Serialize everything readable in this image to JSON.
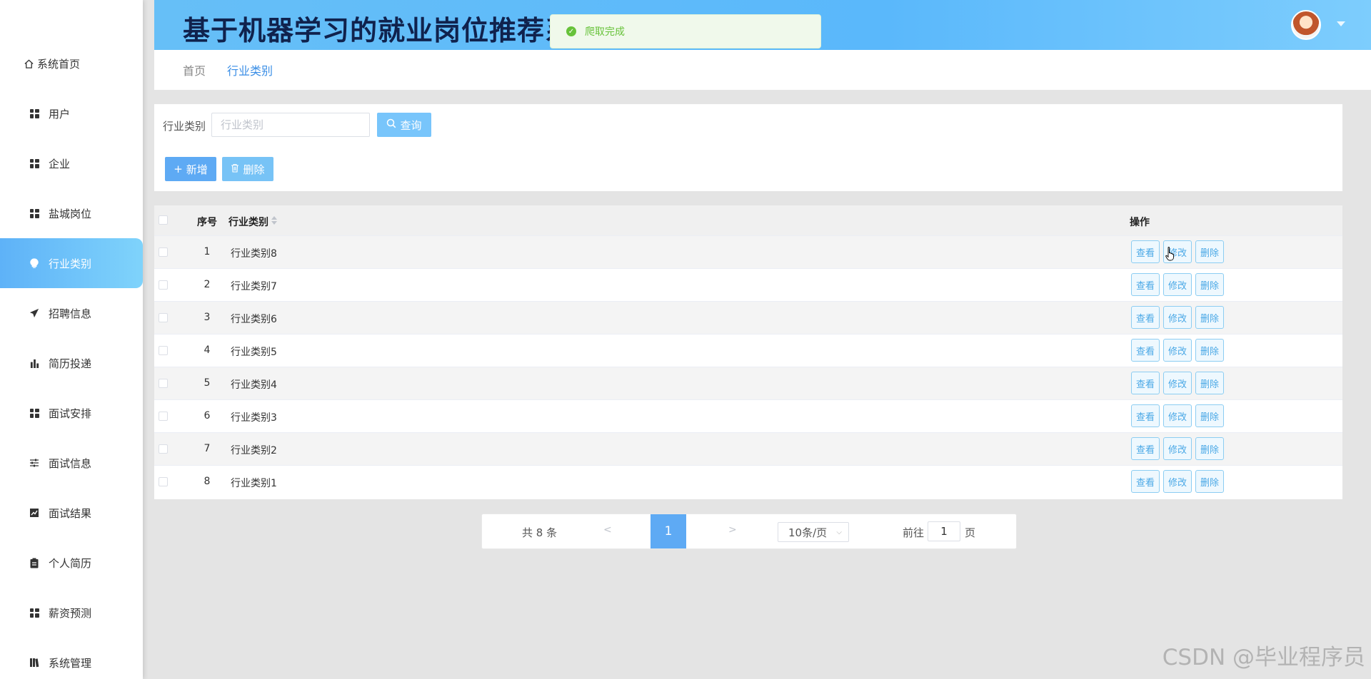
{
  "header": {
    "title": "基于机器学习的就业岗位推荐系统"
  },
  "toast": {
    "message": "爬取完成"
  },
  "sidebar": {
    "items": [
      {
        "label": "系统首页",
        "icon": "home-icon"
      },
      {
        "label": "用户",
        "icon": "grid-icon"
      },
      {
        "label": "企业",
        "icon": "grid-icon"
      },
      {
        "label": "盐城岗位",
        "icon": "grid-icon"
      },
      {
        "label": "行业类别",
        "icon": "bulb-icon",
        "active": true
      },
      {
        "label": "招聘信息",
        "icon": "send-icon"
      },
      {
        "label": "简历投递",
        "icon": "bar-chart-icon"
      },
      {
        "label": "面试安排",
        "icon": "grid-icon"
      },
      {
        "label": "面试信息",
        "icon": "sliders-icon"
      },
      {
        "label": "面试结果",
        "icon": "line-chart-icon"
      },
      {
        "label": "个人简历",
        "icon": "clipboard-icon"
      },
      {
        "label": "薪资预测",
        "icon": "grid-icon"
      },
      {
        "label": "系统管理",
        "icon": "book-icon"
      }
    ]
  },
  "breadcrumb": {
    "home": "首页",
    "current": "行业类别"
  },
  "search": {
    "label": "行业类别",
    "placeholder": "行业类别",
    "query_label": "查询"
  },
  "actions": {
    "add_label": "新增",
    "delete_label": "删除"
  },
  "table": {
    "headers": {
      "index": "序号",
      "category": "行业类别",
      "ops": "操作"
    },
    "rows": [
      {
        "index": "1",
        "category": "行业类别8"
      },
      {
        "index": "2",
        "category": "行业类别7"
      },
      {
        "index": "3",
        "category": "行业类别6"
      },
      {
        "index": "4",
        "category": "行业类别5"
      },
      {
        "index": "5",
        "category": "行业类别4"
      },
      {
        "index": "6",
        "category": "行业类别3"
      },
      {
        "index": "7",
        "category": "行业类别2"
      },
      {
        "index": "8",
        "category": "行业类别1"
      }
    ],
    "row_actions": {
      "view": "查看",
      "edit": "修改",
      "delete": "删除"
    }
  },
  "pagination": {
    "total": "共 8 条",
    "prev": "<",
    "current_page": "1",
    "next": ">",
    "page_size": "10条/页",
    "goto_label": "前往",
    "goto_value": "1",
    "goto_unit": "页"
  },
  "watermark": "CSDN @毕业程序员",
  "colors": {
    "accent": "#5eaaf4",
    "header_gradient_start": "#66bff7",
    "title_color": "#10224d",
    "toast_success": "#67c23a"
  }
}
